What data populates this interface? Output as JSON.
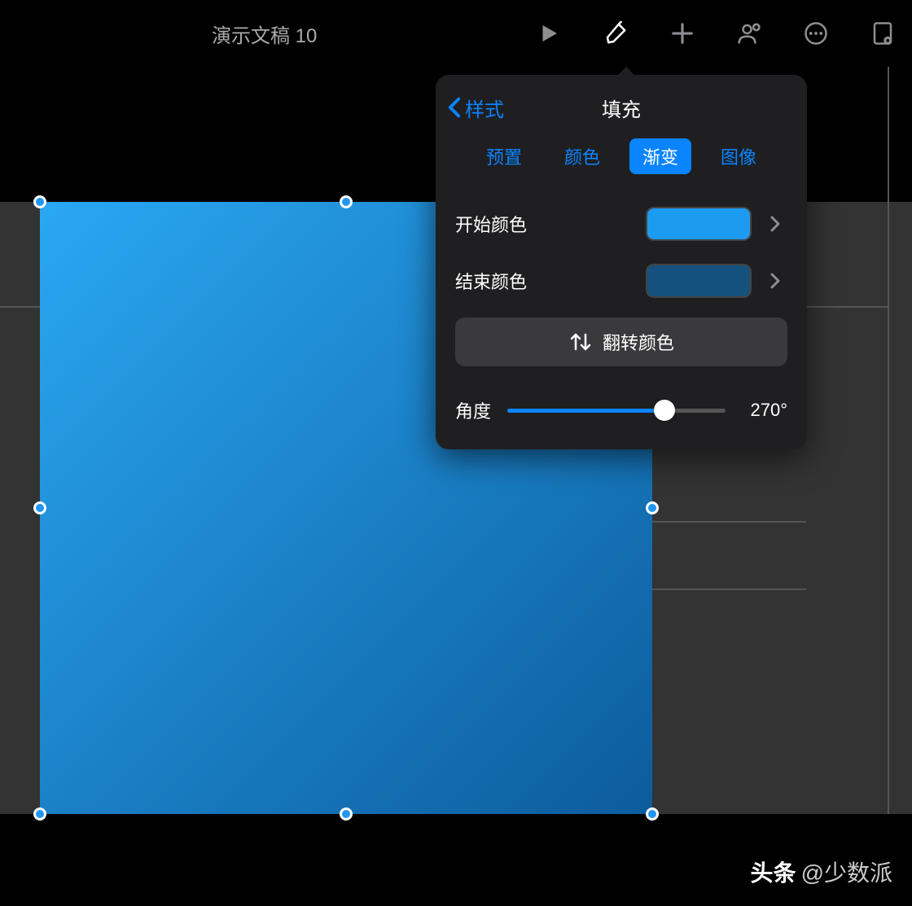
{
  "doc_title": "演示文稿 10",
  "popover": {
    "back_label": "样式",
    "title": "填充",
    "tabs": {
      "preset": "预置",
      "color": "颜色",
      "gradient": "渐变",
      "image": "图像"
    },
    "active_tab": "渐变",
    "start_color_label": "开始颜色",
    "end_color_label": "结束颜色",
    "start_color": "#1d9bf0",
    "end_color": "#14517d",
    "flip_label": "翻转颜色",
    "angle_label": "角度",
    "angle_value": "270°",
    "angle_percent": 72
  },
  "watermark": {
    "brand": "头条",
    "handle": "@少数派"
  }
}
